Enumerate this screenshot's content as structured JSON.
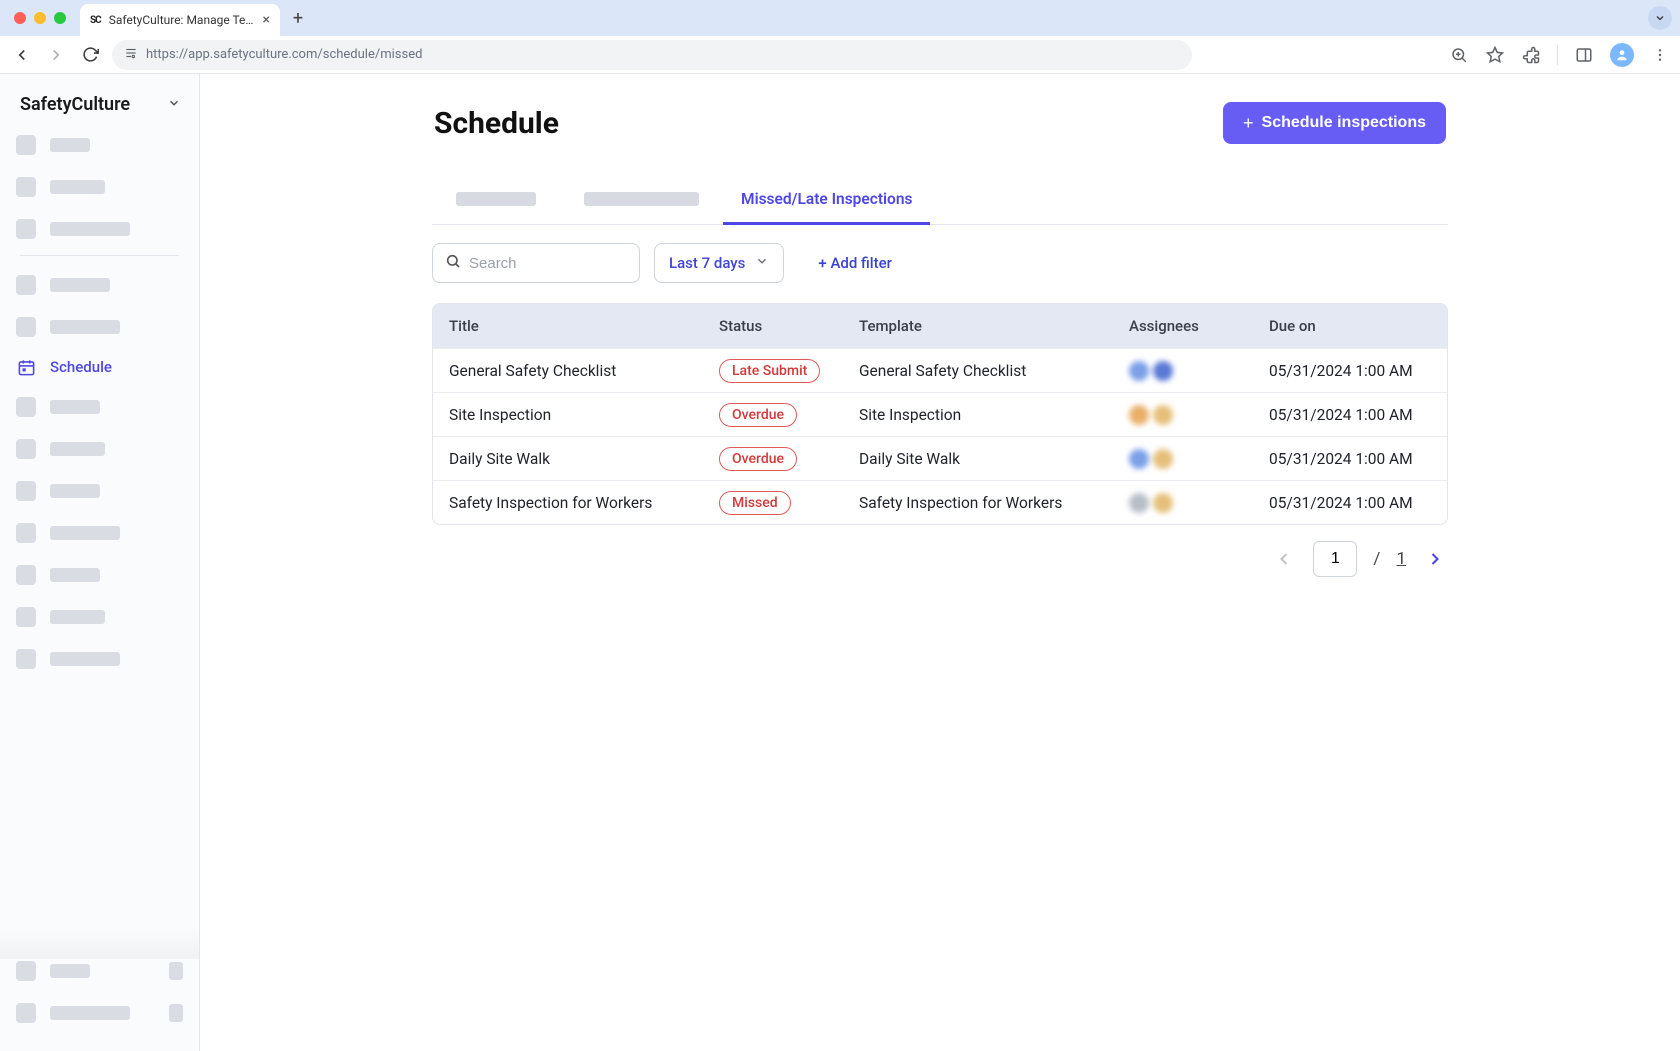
{
  "browser": {
    "tab_title": "SafetyCulture: Manage Teams and...",
    "url": "https://app.safetyculture.com/schedule/missed"
  },
  "sidebar": {
    "brand": "SafetyCulture",
    "active_item_label": "Schedule"
  },
  "header": {
    "title": "Schedule",
    "primary_button": "Schedule inspections"
  },
  "tabs": {
    "active": "Missed/Late Inspections"
  },
  "filters": {
    "search_placeholder": "Search",
    "date_range": "Last 7 days",
    "add_filter": "+ Add filter"
  },
  "table": {
    "columns": [
      "Title",
      "Status",
      "Template",
      "Assignees",
      "Due on"
    ],
    "rows": [
      {
        "title": "General Safety Checklist",
        "status": "Late Submit",
        "template": "General Safety Checklist",
        "due": "05/31/2024 1:00 AM",
        "avatars": [
          "blue",
          "blue2"
        ]
      },
      {
        "title": "Site Inspection",
        "status": "Overdue",
        "template": "Site Inspection",
        "due": "05/31/2024 1:00 AM",
        "avatars": [
          "orange",
          "orange2"
        ]
      },
      {
        "title": "Daily Site Walk",
        "status": "Overdue",
        "template": "Daily Site Walk",
        "due": "05/31/2024 1:00 AM",
        "avatars": [
          "blue",
          "orange2"
        ]
      },
      {
        "title": "Safety Inspection for Workers",
        "status": "Missed",
        "template": "Safety Inspection for Workers",
        "due": "05/31/2024 1:00 AM",
        "avatars": [
          "gray",
          "orange2"
        ]
      }
    ]
  },
  "pagination": {
    "current": "1",
    "separator": "/",
    "total": "1"
  }
}
